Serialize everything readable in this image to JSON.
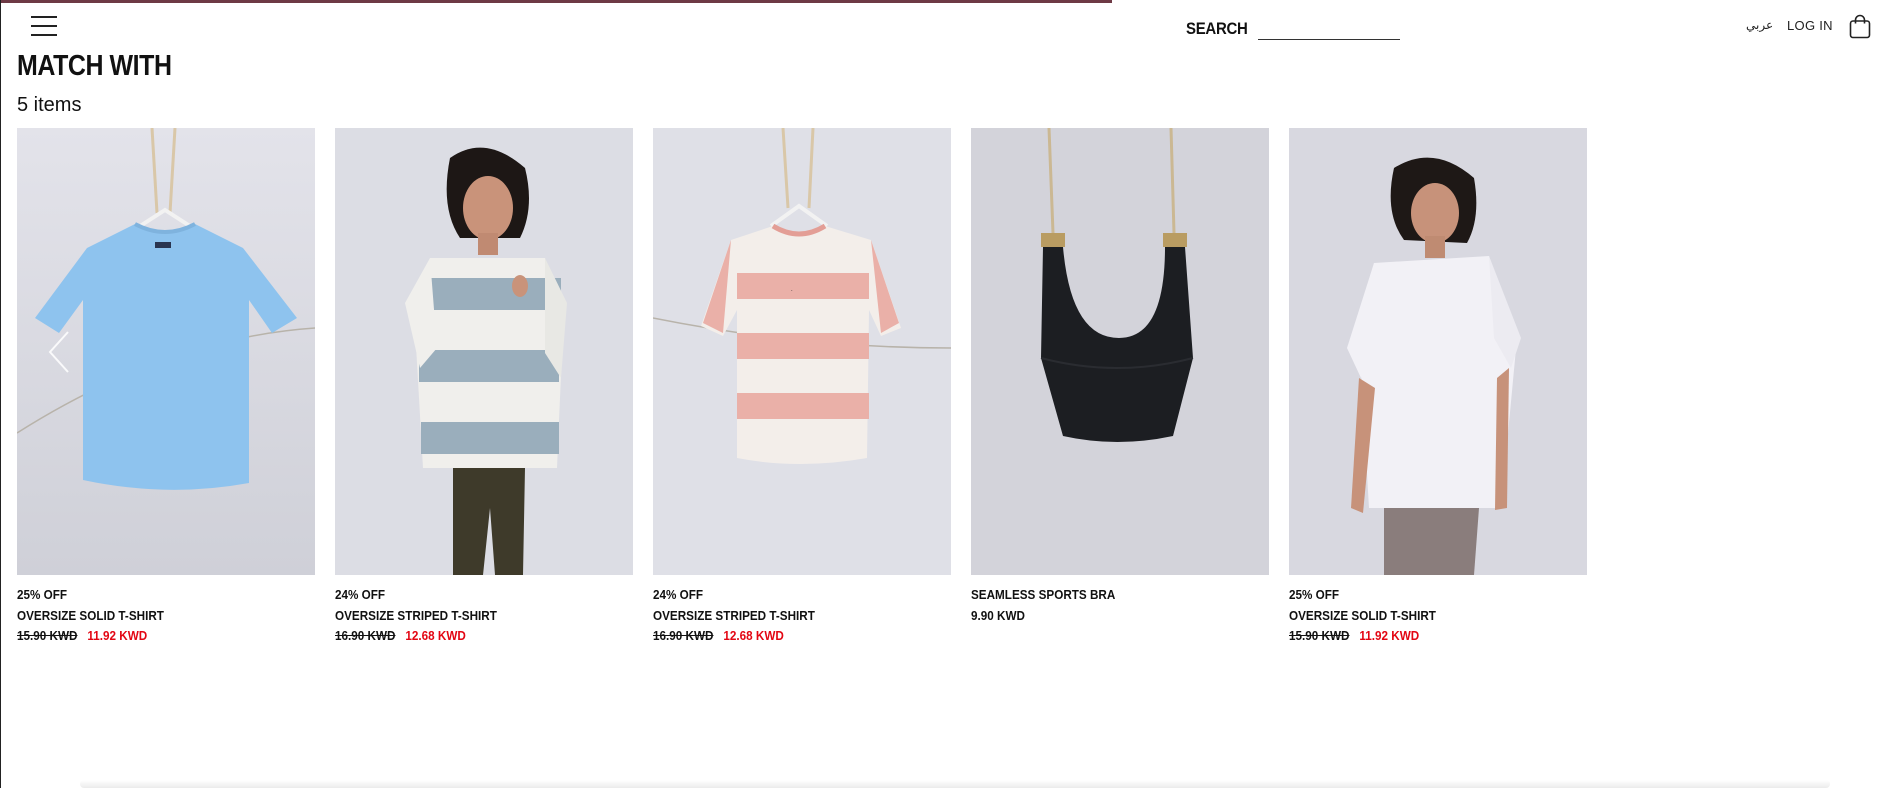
{
  "header": {
    "menu_icon": "hamburger-icon",
    "search_label": "SEARCH",
    "search_placeholder": "",
    "lang_label": "عربي",
    "login_label": "LOG IN",
    "bag_icon": "shopping-bag-icon"
  },
  "section": {
    "title": "MATCH WITH",
    "count": "5 items"
  },
  "carousel": {
    "prev_icon": "chevron-left-icon"
  },
  "products": [
    {
      "discount": "25% OFF",
      "name": "OVERSIZE SOLID T-SHIRT",
      "old_price": "15.90 KWD",
      "price": "11.92 KWD",
      "color": "#8ec3ee"
    },
    {
      "discount": "24% OFF",
      "name": "OVERSIZE STRIPED T-SHIRT",
      "old_price": "16.90 KWD",
      "price": "12.68 KWD",
      "color": "#9aaebc"
    },
    {
      "discount": "24% OFF",
      "name": "OVERSIZE STRIPED T-SHIRT",
      "old_price": "16.90 KWD",
      "price": "12.68 KWD",
      "color": "#eab0a8"
    },
    {
      "discount": "",
      "name": "SEAMLESS SPORTS BRA",
      "old_price": "",
      "price": "9.90 KWD",
      "color": "#1c1e22"
    },
    {
      "discount": "25% OFF",
      "name": "OVERSIZE SOLID T-SHIRT",
      "old_price": "15.90 KWD",
      "price": "11.92 KWD",
      "color": "#f2f1f6"
    }
  ],
  "colors": {
    "sale_red": "#e30613",
    "text_dark": "#111111",
    "image_bg": "#d6d6de"
  }
}
